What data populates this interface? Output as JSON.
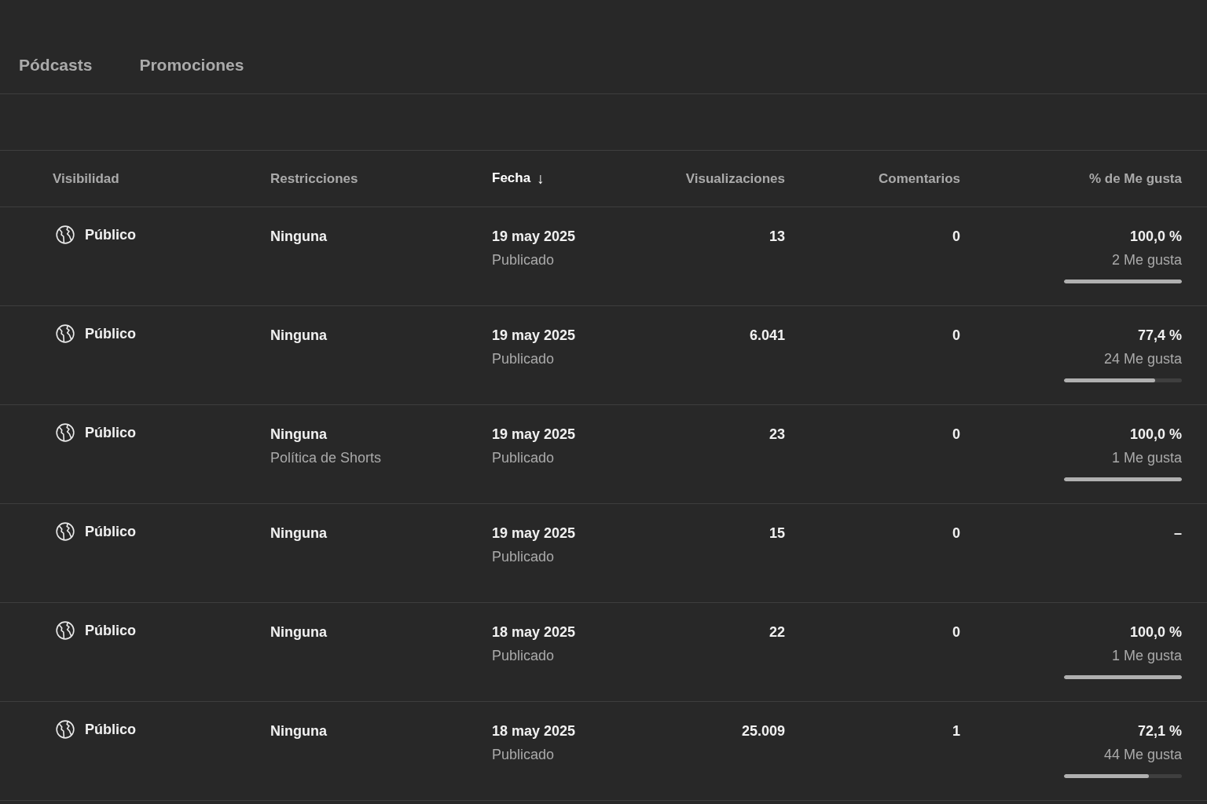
{
  "tabs": [
    {
      "label": "Pódcasts",
      "selected": false
    },
    {
      "label": "Promociones",
      "selected": false
    }
  ],
  "table": {
    "columns": [
      {
        "label": "Visibilidad",
        "sorted": false
      },
      {
        "label": "Restricciones",
        "sorted": false
      },
      {
        "label": "Fecha",
        "sorted": true,
        "sort_icon": "↓"
      },
      {
        "label": "Visualizaciones",
        "sorted": false
      },
      {
        "label": "Comentarios",
        "sorted": false
      },
      {
        "label": "% de Me gusta",
        "sorted": false
      }
    ],
    "rows": [
      {
        "visibility": "Público",
        "restriction": "Ninguna",
        "date": "19 may 2025",
        "status": "Publicado",
        "views": "13",
        "comments": "0",
        "likes_pct": "100,0 %",
        "likes_count": "2 Me gusta",
        "level": 1
      },
      {
        "visibility": "Público",
        "restriction": "Ninguna",
        "date": "19 may 2025",
        "status": "Publicado",
        "views": "6.041",
        "comments": "0",
        "likes_pct": "77,4 %",
        "likes_count": "24 Me gusta",
        "level": 0.774
      },
      {
        "visibility": "Público",
        "restriction": "Ninguna",
        "restriction_note": "Política de Shorts",
        "date": "19 may 2025",
        "status": "Publicado",
        "views": "23",
        "comments": "0",
        "likes_pct": "100,0 %",
        "likes_count": "1 Me gusta",
        "level": 1
      },
      {
        "visibility": "Público",
        "restriction": "Ninguna",
        "date": "19 may 2025",
        "status": "Publicado",
        "views": "15",
        "comments": "0",
        "likes_pct": "–"
      },
      {
        "visibility": "Público",
        "restriction": "Ninguna",
        "date": "18 may 2025",
        "status": "Publicado",
        "views": "22",
        "comments": "0",
        "likes_pct": "100,0 %",
        "likes_count": "1 Me gusta",
        "level": 1
      },
      {
        "visibility": "Público",
        "restriction": "Ninguna",
        "date": "18 may 2025",
        "status": "Publicado",
        "views": "25.009",
        "comments": "1",
        "likes_pct": "72,1 %",
        "likes_count": "44 Me gusta",
        "level": 0.721
      }
    ]
  }
}
